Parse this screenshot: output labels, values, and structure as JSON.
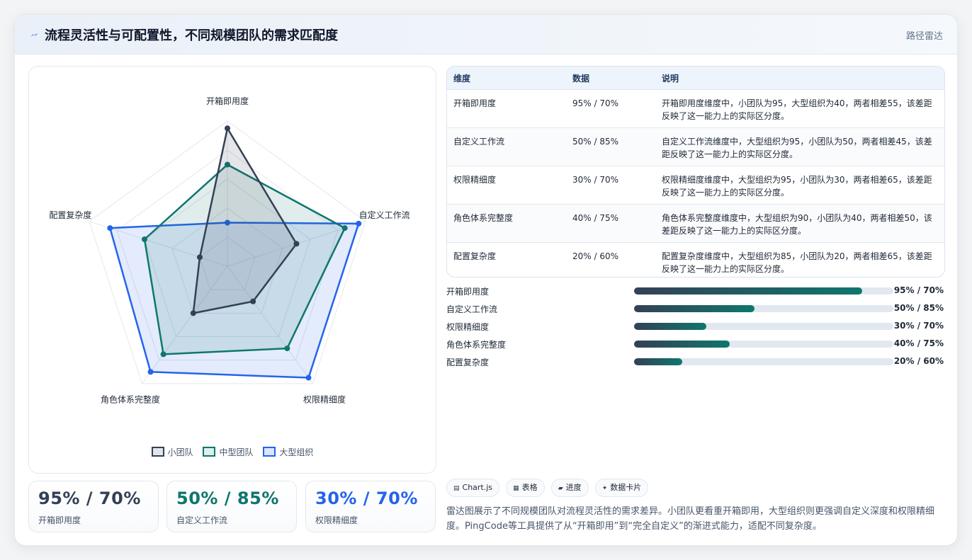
{
  "header": {
    "title": "流程灵活性与可配置性，不同规模团队的需求匹配度",
    "icon": "lightning-icon",
    "tag": "路径雷达"
  },
  "chart_data": {
    "type": "radar",
    "axes": [
      "开箱即用度",
      "自定义工作流",
      "权限精细度",
      "角色体系完整度",
      "配置复杂度"
    ],
    "rmax": 100,
    "series": [
      {
        "name": "小团队",
        "values": [
          95,
          50,
          30,
          40,
          20
        ],
        "color": "#334155"
      },
      {
        "name": "中型团队",
        "values": [
          70,
          85,
          70,
          75,
          60
        ],
        "color": "#0f766e"
      },
      {
        "name": "大型组织",
        "values": [
          30,
          95,
          95,
          90,
          85
        ],
        "color": "#2563eb"
      }
    ]
  },
  "stats": [
    {
      "value": "95% / 70%",
      "label": "开箱即用度",
      "color": "#334155"
    },
    {
      "value": "50% / 85%",
      "label": "自定义工作流",
      "color": "#0f766e"
    },
    {
      "value": "30% / 70%",
      "label": "权限精细度",
      "color": "#2563eb"
    }
  ],
  "table": {
    "headers": [
      "维度",
      "数据",
      "说明"
    ],
    "rows": [
      {
        "dim": "开箱即用度",
        "data": "95% / 70%",
        "note": "开箱即用度维度中，小团队为95，大型组织为40，两者相差55，该差距反映了这一能力上的实际区分度。"
      },
      {
        "dim": "自定义工作流",
        "data": "50% / 85%",
        "note": "自定义工作流维度中，大型组织为95，小团队为50，两者相差45，该差距反映了这一能力上的实际区分度。"
      },
      {
        "dim": "权限精细度",
        "data": "30% / 70%",
        "note": "权限精细度维度中，大型组织为95，小团队为30，两者相差65，该差距反映了这一能力上的实际区分度。"
      },
      {
        "dim": "角色体系完整度",
        "data": "40% / 75%",
        "note": "角色体系完整度维度中，大型组织为90，小团队为40，两者相差50，该差距反映了这一能力上的实际区分度。"
      },
      {
        "dim": "配置复杂度",
        "data": "20% / 60%",
        "note": "配置复杂度维度中，大型组织为85，小团队为20，两者相差65，该差距反映了这一能力上的实际区分度。"
      }
    ]
  },
  "progress": [
    {
      "label": "开箱即用度",
      "value": "95% / 70%",
      "fraction": 0.88
    },
    {
      "label": "自定义工作流",
      "value": "50% / 85%",
      "fraction": 0.465
    },
    {
      "label": "权限精细度",
      "value": "30% / 70%",
      "fraction": 0.28
    },
    {
      "label": "角色体系完整度",
      "value": "40% / 75%",
      "fraction": 0.37
    },
    {
      "label": "配置复杂度",
      "value": "20% / 60%",
      "fraction": 0.185
    }
  ],
  "chips": [
    {
      "label": "Chart.js",
      "icon": "chart-icon"
    },
    {
      "label": "表格",
      "icon": "table-icon"
    },
    {
      "label": "进度",
      "icon": "progress-icon"
    },
    {
      "label": "数据卡片",
      "icon": "sparkle-icon"
    }
  ],
  "description": "雷达图展示了不同规模团队对流程灵活性的需求差异。小团队更看重开箱即用，大型组织则更强调自定义深度和权限精细度。PingCode等工具提供了从“开箱即用”到“完全自定义”的渐进式能力，适配不同复杂度。"
}
